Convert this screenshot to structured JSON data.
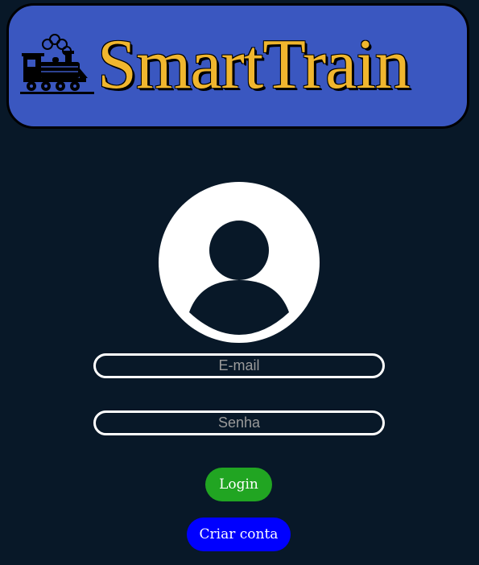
{
  "header": {
    "logo_icon": "steam-train-icon",
    "brand_name": "SmartTrain"
  },
  "avatar": {
    "icon": "user-profile-icon"
  },
  "form": {
    "email_placeholder": "E-mail",
    "email_value": "",
    "password_placeholder": "Senha",
    "password_value": ""
  },
  "buttons": {
    "login_label": "Login",
    "create_account_label": "Criar conta"
  },
  "colors": {
    "background": "#081828",
    "header_bg": "#3a57c0",
    "brand_text": "#f0b62e",
    "login_button": "#21a522",
    "create_account_button": "#0000ff",
    "field_border": "#ffffff"
  }
}
